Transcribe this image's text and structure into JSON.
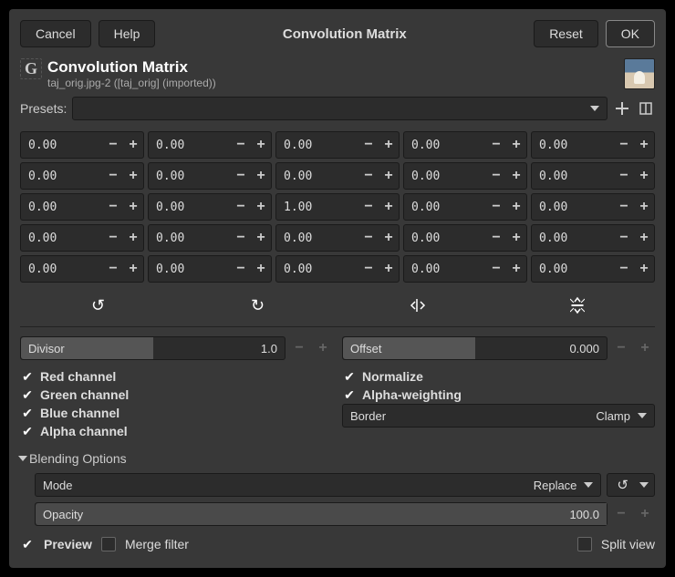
{
  "header": {
    "cancel": "Cancel",
    "help": "Help",
    "title": "Convolution Matrix",
    "reset": "Reset",
    "ok": "OK"
  },
  "title": {
    "main": "Convolution Matrix",
    "sub": "taj_orig.jpg-2 ([taj_orig] (imported))"
  },
  "presets_label": "Presets:",
  "matrix": [
    [
      "0.00",
      "0.00",
      "0.00",
      "0.00",
      "0.00"
    ],
    [
      "0.00",
      "0.00",
      "0.00",
      "0.00",
      "0.00"
    ],
    [
      "0.00",
      "0.00",
      "1.00",
      "0.00",
      "0.00"
    ],
    [
      "0.00",
      "0.00",
      "0.00",
      "0.00",
      "0.00"
    ],
    [
      "0.00",
      "0.00",
      "0.00",
      "0.00",
      "0.00"
    ]
  ],
  "divisor": {
    "label": "Divisor",
    "value": "1.0"
  },
  "offset": {
    "label": "Offset",
    "value": "0.000"
  },
  "channels": {
    "red": "Red channel",
    "green": "Green channel",
    "blue": "Blue channel",
    "alpha": "Alpha channel"
  },
  "options": {
    "normalize": "Normalize",
    "alpha_weighting": "Alpha-weighting"
  },
  "border": {
    "label": "Border",
    "value": "Clamp"
  },
  "blending": {
    "header": "Blending Options",
    "mode_label": "Mode",
    "mode_value": "Replace",
    "opacity_label": "Opacity",
    "opacity_value": "100.0"
  },
  "bottom": {
    "preview": "Preview",
    "merge": "Merge filter",
    "split": "Split view"
  }
}
